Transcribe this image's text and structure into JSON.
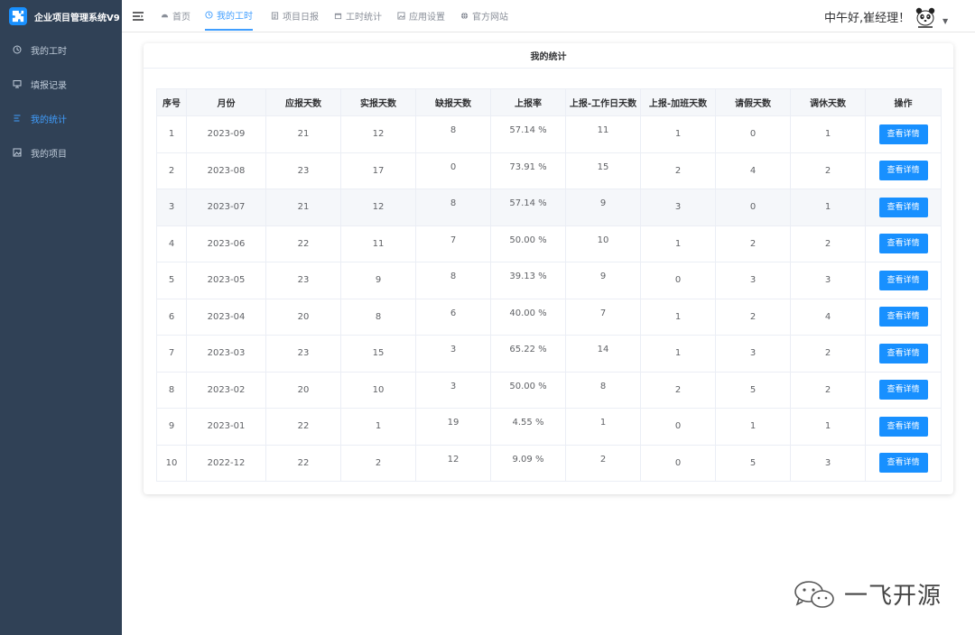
{
  "app": {
    "title": "企业项目管理系统V9"
  },
  "sidebar": {
    "items": [
      {
        "label": "我的工时",
        "icon": "clock-icon",
        "active": false
      },
      {
        "label": "填报记录",
        "icon": "monitor-icon",
        "active": false
      },
      {
        "label": "我的统计",
        "icon": "chart-icon",
        "active": true
      },
      {
        "label": "我的项目",
        "icon": "picture-icon",
        "active": false
      }
    ]
  },
  "topbar": {
    "tabs": [
      {
        "label": "首页",
        "icon": "dashboard-icon"
      },
      {
        "label": "我的工时",
        "icon": "clock-icon",
        "active": true
      },
      {
        "label": "项目日报",
        "icon": "document-icon"
      },
      {
        "label": "工时统计",
        "icon": "calendar-icon"
      },
      {
        "label": "应用设置",
        "icon": "picture-icon"
      },
      {
        "label": "官方网站",
        "icon": "globe-icon"
      }
    ],
    "greeting": "中午好,崔经理！"
  },
  "card": {
    "title": "我的统计"
  },
  "table": {
    "headers": [
      "序号",
      "月份",
      "应报天数",
      "实报天数",
      "缺报天数",
      "上报率",
      "上报-工作日天数",
      "上报-加班天数",
      "请假天数",
      "调休天数",
      "操作"
    ],
    "action_label": "查看详情",
    "rows": [
      [
        "1",
        "2023-09",
        "21",
        "12",
        "8",
        "57.14 %",
        "11",
        "1",
        "0",
        "1"
      ],
      [
        "2",
        "2023-08",
        "23",
        "17",
        "0",
        "73.91 %",
        "15",
        "2",
        "4",
        "2"
      ],
      [
        "3",
        "2023-07",
        "21",
        "12",
        "8",
        "57.14 %",
        "9",
        "3",
        "0",
        "1"
      ],
      [
        "4",
        "2023-06",
        "22",
        "11",
        "7",
        "50.00 %",
        "10",
        "1",
        "2",
        "2"
      ],
      [
        "5",
        "2023-05",
        "23",
        "9",
        "8",
        "39.13 %",
        "9",
        "0",
        "3",
        "3"
      ],
      [
        "6",
        "2023-04",
        "20",
        "8",
        "6",
        "40.00 %",
        "7",
        "1",
        "2",
        "4"
      ],
      [
        "7",
        "2023-03",
        "23",
        "15",
        "3",
        "65.22 %",
        "14",
        "1",
        "3",
        "2"
      ],
      [
        "8",
        "2023-02",
        "20",
        "10",
        "3",
        "50.00 %",
        "8",
        "2",
        "5",
        "2"
      ],
      [
        "9",
        "2023-01",
        "22",
        "1",
        "19",
        "4.55 %",
        "1",
        "0",
        "1",
        "1"
      ],
      [
        "10",
        "2022-12",
        "22",
        "2",
        "12",
        "9.09 %",
        "2",
        "0",
        "5",
        "3"
      ]
    ]
  },
  "watermark": {
    "text": "一飞开源"
  }
}
